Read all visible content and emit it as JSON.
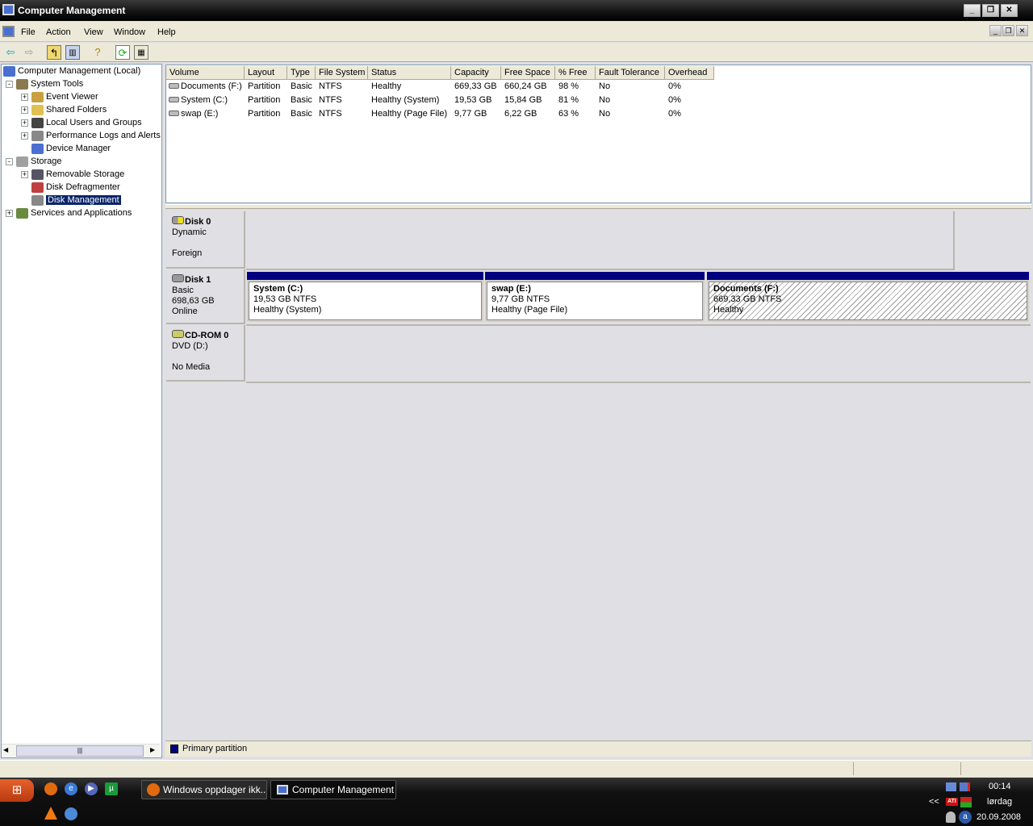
{
  "window": {
    "title": "Computer Management",
    "minimize": "0",
    "restore": "1",
    "close": "r"
  },
  "menu": [
    "File",
    "Action",
    "View",
    "Window",
    "Help"
  ],
  "toolbar_icons": [
    "back-icon",
    "forward-icon",
    "up-folder-icon",
    "show-hide-tree-icon",
    "help-icon",
    "refresh-icon",
    "properties-icon"
  ],
  "tree": [
    {
      "label": "Computer Management (Local)",
      "level": 0,
      "icon": "computer-icon",
      "expander": ""
    },
    {
      "label": "System Tools",
      "level": 1,
      "icon": "tools-icon",
      "expander": "-"
    },
    {
      "label": "Event Viewer",
      "level": 2,
      "icon": "event-viewer-icon",
      "expander": "+"
    },
    {
      "label": "Shared Folders",
      "level": 2,
      "icon": "shared-folder-icon",
      "expander": "+"
    },
    {
      "label": "Local Users and Groups",
      "level": 2,
      "icon": "users-icon",
      "expander": "+"
    },
    {
      "label": "Performance Logs and Alerts",
      "level": 2,
      "icon": "performance-icon",
      "expander": "+"
    },
    {
      "label": "Device Manager",
      "level": 2,
      "icon": "device-manager-icon",
      "expander": ""
    },
    {
      "label": "Storage",
      "level": 1,
      "icon": "storage-icon",
      "expander": "-"
    },
    {
      "label": "Removable Storage",
      "level": 2,
      "icon": "removable-storage-icon",
      "expander": "+"
    },
    {
      "label": "Disk Defragmenter",
      "level": 2,
      "icon": "defrag-icon",
      "expander": ""
    },
    {
      "label": "Disk Management",
      "level": 2,
      "icon": "disk-management-icon",
      "expander": "",
      "selected": true
    },
    {
      "label": "Services and Applications",
      "level": 1,
      "icon": "services-icon",
      "expander": "+"
    }
  ],
  "volumes": {
    "columns": [
      "Volume",
      "Layout",
      "Type",
      "File System",
      "Status",
      "Capacity",
      "Free Space",
      "% Free",
      "Fault Tolerance",
      "Overhead"
    ],
    "rows": [
      [
        "Documents (F:)",
        "Partition",
        "Basic",
        "NTFS",
        "Healthy",
        "669,33 GB",
        "660,24 GB",
        "98 %",
        "No",
        "0%"
      ],
      [
        "System (C:)",
        "Partition",
        "Basic",
        "NTFS",
        "Healthy (System)",
        "19,53 GB",
        "15,84 GB",
        "81 %",
        "No",
        "0%"
      ],
      [
        "swap (E:)",
        "Partition",
        "Basic",
        "NTFS",
        "Healthy (Page File)",
        "9,77 GB",
        "6,22 GB",
        "63 %",
        "No",
        "0%"
      ]
    ]
  },
  "disks": [
    {
      "name": "Disk 0",
      "type": "Dynamic",
      "size": "",
      "state": "Foreign",
      "partitions": []
    },
    {
      "name": "Disk 1",
      "type": "Basic",
      "size": "698,63 GB",
      "state": "Online",
      "partitions": [
        {
          "name": "System  (C:)",
          "size": "19,53 GB NTFS",
          "status": "Healthy (System)"
        },
        {
          "name": "swap  (E:)",
          "size": "9,77 GB NTFS",
          "status": "Healthy (Page File)"
        },
        {
          "name": "Documents  (F:)",
          "size": "669,33 GB NTFS",
          "status": "Healthy"
        }
      ]
    },
    {
      "name": "CD-ROM 0",
      "type": "DVD (D:)",
      "size": "",
      "state": "No Media",
      "partitions": []
    }
  ],
  "legend": {
    "label": "Primary partition",
    "color": "#000080"
  },
  "taskbar": {
    "tasks": [
      "Windows oppdager ikk...",
      "Computer Management"
    ],
    "tray_expand": "<<",
    "time": "00:14",
    "day": "lørdag",
    "date": "20.09.2008"
  }
}
